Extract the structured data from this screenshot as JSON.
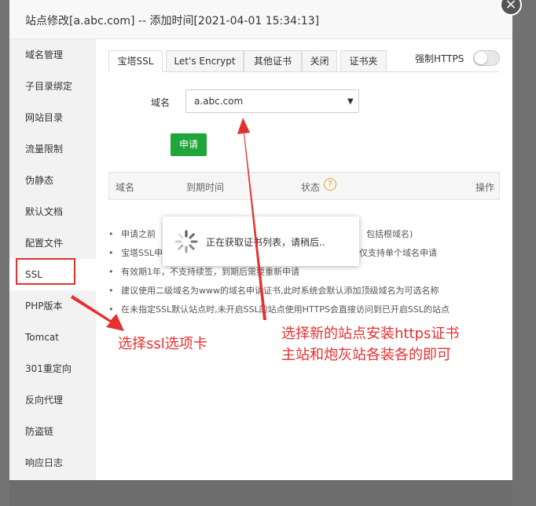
{
  "modal": {
    "title": "站点修改[a.abc.com] -- 添加时间[2021-04-01 15:34:13]",
    "close_glyph": "×"
  },
  "menu": {
    "items": [
      {
        "label": "域名管理"
      },
      {
        "label": "子目录绑定"
      },
      {
        "label": "网站目录"
      },
      {
        "label": "流量限制"
      },
      {
        "label": "伪静态"
      },
      {
        "label": "默认文档"
      },
      {
        "label": "配置文件"
      },
      {
        "label": "SSL"
      },
      {
        "label": "PHP版本"
      },
      {
        "label": "Tomcat"
      },
      {
        "label": "301重定向"
      },
      {
        "label": "反向代理"
      },
      {
        "label": "防盗链"
      },
      {
        "label": "响应日志"
      }
    ],
    "active_index": 7
  },
  "tabs": [
    {
      "label": "宝塔SSL",
      "active": true
    },
    {
      "label": "Let's Encrypt",
      "active": false
    },
    {
      "label": "其他证书",
      "active": false
    },
    {
      "label": "关闭",
      "active": false
    },
    {
      "label": "证书夹",
      "active": false
    }
  ],
  "force_https": {
    "label": "强制HTTPS",
    "enabled": false
  },
  "form": {
    "domain_label": "域名",
    "domain_value": "a.abc.com",
    "apply_label": "申请"
  },
  "table": {
    "headers": {
      "domain": "域名",
      "expire": "到期时间",
      "status": "状态",
      "help": "?",
      "action": "操作"
    }
  },
  "notes": [
    {
      "before": "申请之前",
      "after": "包括根域名)"
    },
    {
      "before": "宝塔SSL申",
      "after": "仅支持单个域名申请"
    },
    {
      "before": "有效期1年，不支持续签，到期后需要重新申请",
      "after": ""
    },
    {
      "before": "建议使用二级域名为www的域名申请证书,此时系统会默认添加顶级域名为可选名称",
      "after": ""
    },
    {
      "before": "在未指定SSL默认站点时,未开启SSL的站点使用HTTPS会直接访问到已开启SSL的站点",
      "after": ""
    }
  ],
  "loading": {
    "text": "正在获取证书列表，请稍后.."
  },
  "annotations": {
    "ssl_tab": "选择ssl选项卡",
    "site_line1": "选择新的站点安装https证书",
    "site_line2": "主站和炮灰站各装各的即可",
    "color": "#e53030"
  },
  "colors": {
    "apply_button": "#20a53a",
    "help_icon": "#f0a020"
  }
}
